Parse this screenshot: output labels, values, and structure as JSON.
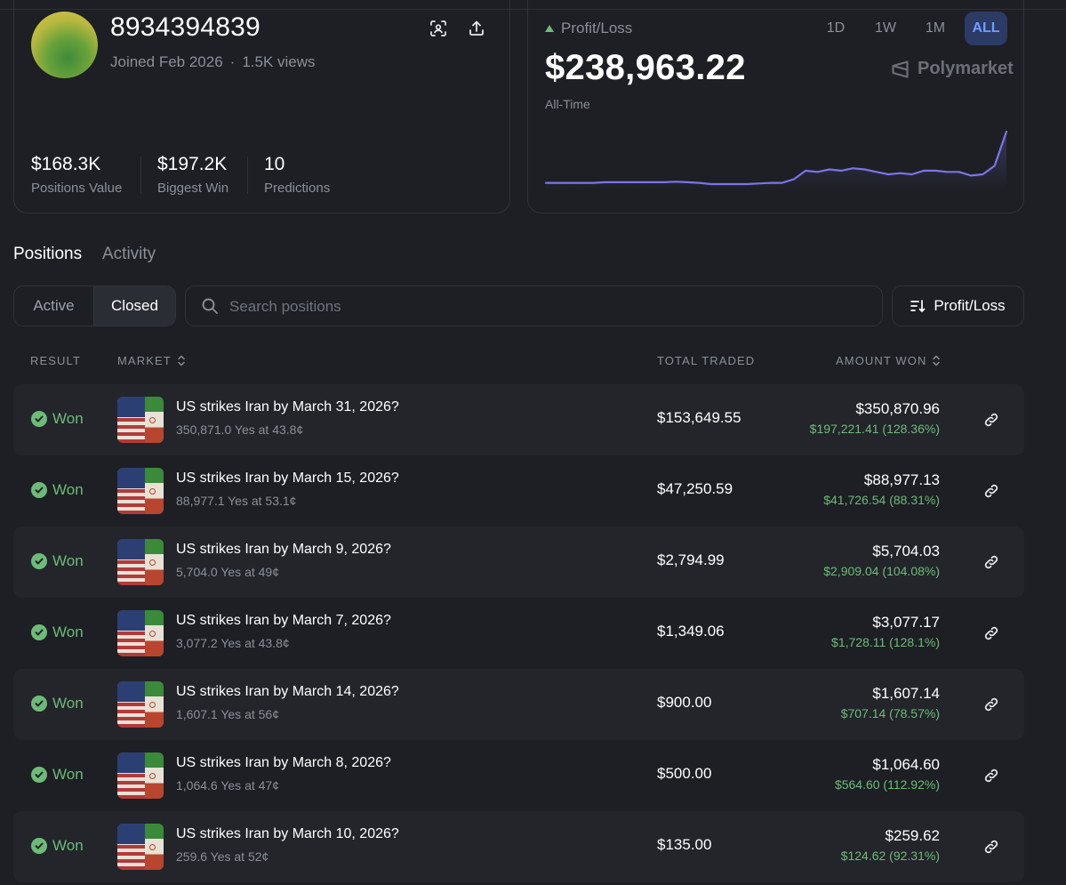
{
  "profile": {
    "username": "8934394839",
    "joined": "Joined Feb 2026",
    "views": "1.5K views",
    "stats": [
      {
        "value": "$168.3K",
        "label": "Positions Value"
      },
      {
        "value": "$197.2K",
        "label": "Biggest Win"
      },
      {
        "value": "10",
        "label": "Predictions"
      }
    ]
  },
  "pnl": {
    "label": "Profit/Loss",
    "value": "$238,963.22",
    "period_label": "All-Time",
    "brand": "Polymarket",
    "ranges": [
      "1D",
      "1W",
      "1M",
      "ALL"
    ],
    "active_range": "ALL",
    "sparkline": [
      20,
      20,
      20,
      20,
      20,
      20.5,
      20.5,
      20.5,
      20.5,
      20.5,
      20.5,
      21,
      20.5,
      20,
      19,
      19,
      19,
      19,
      19.5,
      20,
      20,
      23,
      30,
      29,
      31,
      30,
      32,
      31,
      29,
      27,
      28,
      27,
      30,
      30,
      29,
      29,
      26,
      27,
      34,
      62
    ],
    "colors": {
      "line": "#7b74e8",
      "positive": "#6dbb78",
      "active_bg": "#2b3b66",
      "active_text": "#6f9dff"
    }
  },
  "tabs": {
    "positions": "Positions",
    "activity": "Activity"
  },
  "filters": {
    "active": "Active",
    "closed": "Closed",
    "search_placeholder": "Search positions",
    "sort_label": "Profit/Loss"
  },
  "table": {
    "headers": {
      "result": "RESULT",
      "market": "MARKET",
      "total_traded": "TOTAL TRADED",
      "amount_won": "AMOUNT WON"
    },
    "rows": [
      {
        "result": "Won",
        "title": "US strikes Iran by March 31, 2026?",
        "sub": "350,871.0 Yes at 43.8¢",
        "traded": "$153,649.55",
        "won": "$350,870.96",
        "gain": "$197,221.41 (128.36%)"
      },
      {
        "result": "Won",
        "title": "US strikes Iran by March 15, 2026?",
        "sub": "88,977.1 Yes at 53.1¢",
        "traded": "$47,250.59",
        "won": "$88,977.13",
        "gain": "$41,726.54 (88.31%)"
      },
      {
        "result": "Won",
        "title": "US strikes Iran by March 9, 2026?",
        "sub": "5,704.0 Yes at 49¢",
        "traded": "$2,794.99",
        "won": "$5,704.03",
        "gain": "$2,909.04 (104.08%)"
      },
      {
        "result": "Won",
        "title": "US strikes Iran by March 7, 2026?",
        "sub": "3,077.2 Yes at 43.8¢",
        "traded": "$1,349.06",
        "won": "$3,077.17",
        "gain": "$1,728.11 (128.1%)"
      },
      {
        "result": "Won",
        "title": "US strikes Iran by March 14, 2026?",
        "sub": "1,607.1 Yes at 56¢",
        "traded": "$900.00",
        "won": "$1,607.14",
        "gain": "$707.14 (78.57%)"
      },
      {
        "result": "Won",
        "title": "US strikes Iran by March 8, 2026?",
        "sub": "1,064.6 Yes at 47¢",
        "traded": "$500.00",
        "won": "$1,064.60",
        "gain": "$564.60 (112.92%)"
      },
      {
        "result": "Won",
        "title": "US strikes Iran by March 10, 2026?",
        "sub": "259.6 Yes at 52¢",
        "traded": "$135.00",
        "won": "$259.62",
        "gain": "$124.62 (92.31%)"
      }
    ]
  }
}
